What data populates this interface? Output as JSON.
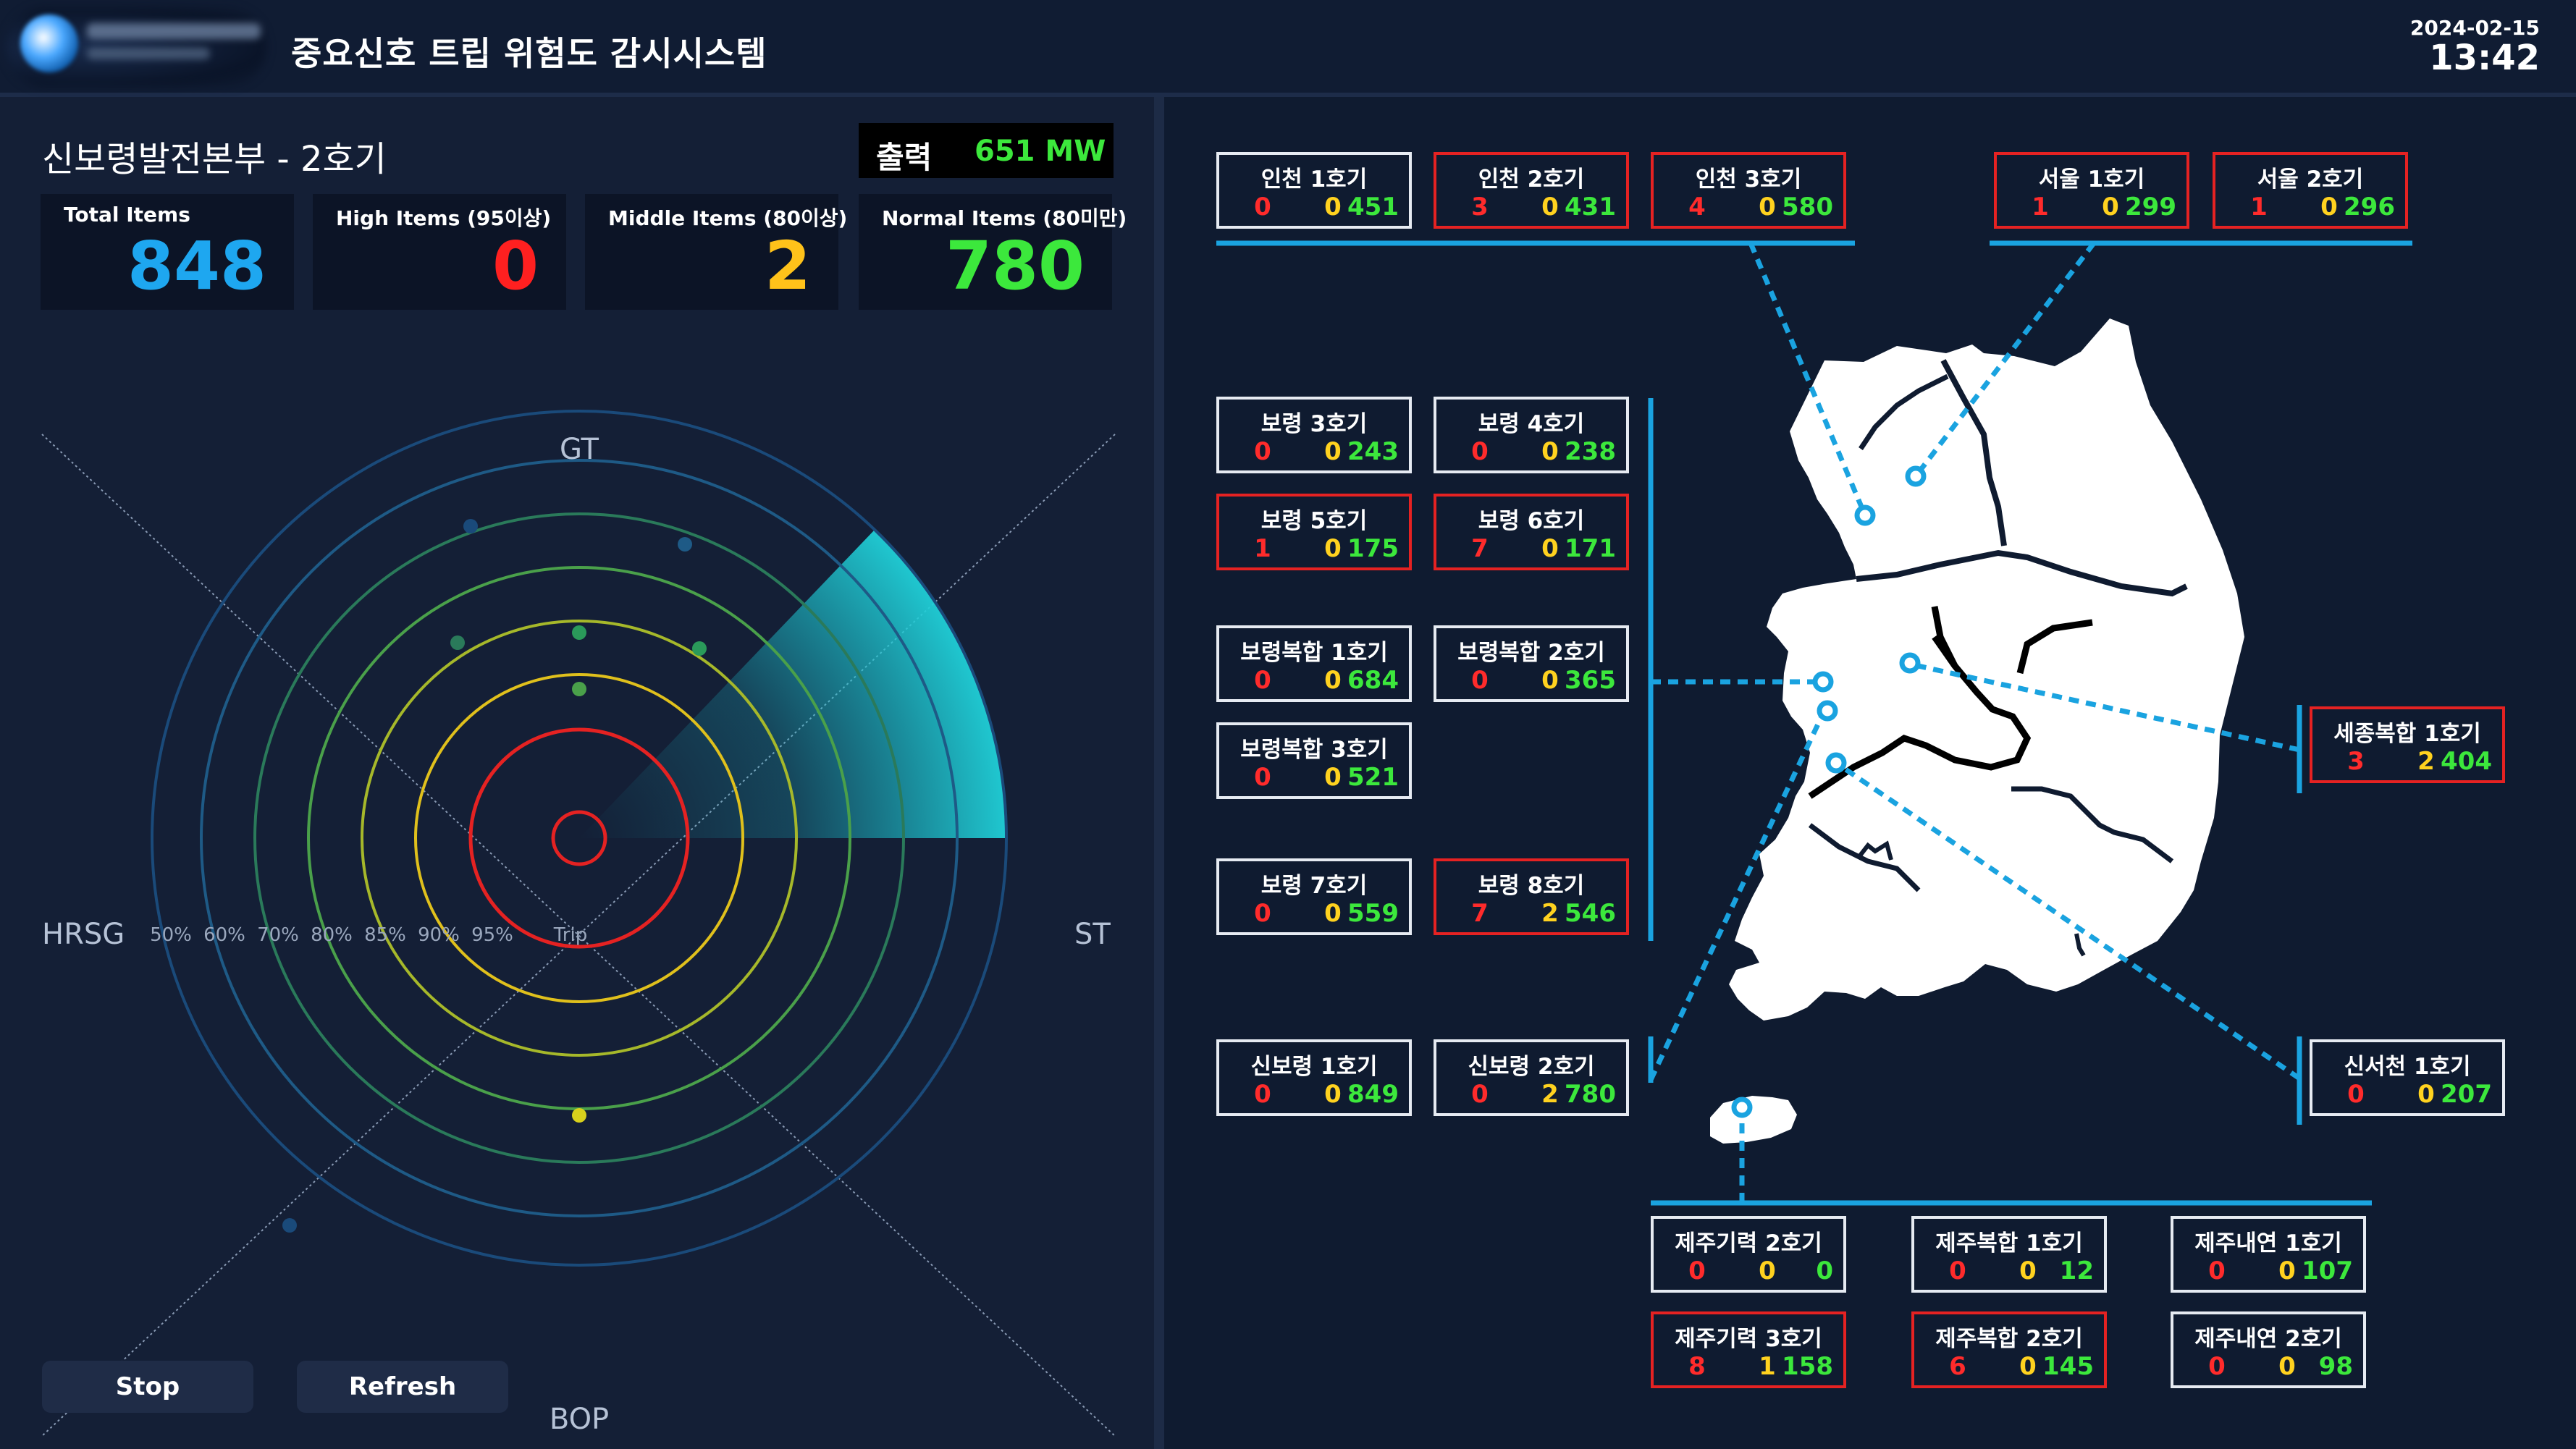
{
  "header": {
    "title": "중요신호 트립 위험도 감시시스템",
    "date": "2024-02-15",
    "time": "13:42"
  },
  "plant": {
    "title": "신보령발전본부 - 2호기",
    "output_label": "출력",
    "output_value": "651 MW"
  },
  "stats": [
    {
      "label": "Total Items",
      "value": "848",
      "color": "#1ea7f0"
    },
    {
      "label": "High Items (95이상)",
      "value": "0",
      "color": "#ff2020"
    },
    {
      "label": "Middle Items (80이상)",
      "value": "2",
      "color": "#ffc21a"
    },
    {
      "label": "Normal Items (80미만)",
      "value": "780",
      "color": "#3ce83c"
    }
  ],
  "radar": {
    "quadrants": {
      "top": "GT",
      "bottom": "BOP",
      "left": "HRSG",
      "right": "ST"
    },
    "ring_labels": [
      "50%",
      "60%",
      "70%",
      "80%",
      "85%",
      "90%",
      "95%",
      "Trip"
    ],
    "ring_colors": [
      "#1a4a7a",
      "#1e5a86",
      "#2a7a5a",
      "#4aa04a",
      "#a6b82a",
      "#e0c01c",
      "#e8a418",
      "#e52222"
    ]
  },
  "controls": {
    "stop_label": "Stop",
    "refresh_label": "Refresh"
  },
  "units": [
    {
      "name": "인천 1호기",
      "high": "0",
      "mid": "0",
      "normal": "451",
      "alert": false
    },
    {
      "name": "인천 2호기",
      "high": "3",
      "mid": "0",
      "normal": "431",
      "alert": true
    },
    {
      "name": "인천 3호기",
      "high": "4",
      "mid": "0",
      "normal": "580",
      "alert": true
    },
    {
      "name": "서울 1호기",
      "high": "1",
      "mid": "0",
      "normal": "299",
      "alert": true
    },
    {
      "name": "서울 2호기",
      "high": "1",
      "mid": "0",
      "normal": "296",
      "alert": true
    },
    {
      "name": "보령 3호기",
      "high": "0",
      "mid": "0",
      "normal": "243",
      "alert": false
    },
    {
      "name": "보령 4호기",
      "high": "0",
      "mid": "0",
      "normal": "238",
      "alert": false
    },
    {
      "name": "보령 5호기",
      "high": "1",
      "mid": "0",
      "normal": "175",
      "alert": true
    },
    {
      "name": "보령 6호기",
      "high": "7",
      "mid": "0",
      "normal": "171",
      "alert": true
    },
    {
      "name": "보령복합 1호기",
      "high": "0",
      "mid": "0",
      "normal": "684",
      "alert": false
    },
    {
      "name": "보령복합 2호기",
      "high": "0",
      "mid": "0",
      "normal": "365",
      "alert": false
    },
    {
      "name": "보령복합 3호기",
      "high": "0",
      "mid": "0",
      "normal": "521",
      "alert": false
    },
    {
      "name": "보령 7호기",
      "high": "0",
      "mid": "0",
      "normal": "559",
      "alert": false
    },
    {
      "name": "보령 8호기",
      "high": "7",
      "mid": "2",
      "normal": "546",
      "alert": true
    },
    {
      "name": "신보령 1호기",
      "high": "0",
      "mid": "0",
      "normal": "849",
      "alert": false
    },
    {
      "name": "신보령 2호기",
      "high": "0",
      "mid": "2",
      "normal": "780",
      "alert": false
    },
    {
      "name": "세종복합 1호기",
      "high": "3",
      "mid": "2",
      "normal": "404",
      "alert": true
    },
    {
      "name": "신서천 1호기",
      "high": "0",
      "mid": "0",
      "normal": "207",
      "alert": false
    },
    {
      "name": "제주기력 2호기",
      "high": "0",
      "mid": "0",
      "normal": "0",
      "alert": false
    },
    {
      "name": "제주복합 1호기",
      "high": "0",
      "mid": "0",
      "normal": "12",
      "alert": false
    },
    {
      "name": "제주내연 1호기",
      "high": "0",
      "mid": "0",
      "normal": "107",
      "alert": false
    },
    {
      "name": "제주기력 3호기",
      "high": "8",
      "mid": "1",
      "normal": "158",
      "alert": true
    },
    {
      "name": "제주복합 2호기",
      "high": "6",
      "mid": "0",
      "normal": "145",
      "alert": true
    },
    {
      "name": "제주내연 2호기",
      "high": "0",
      "mid": "0",
      "normal": "98",
      "alert": false
    }
  ]
}
